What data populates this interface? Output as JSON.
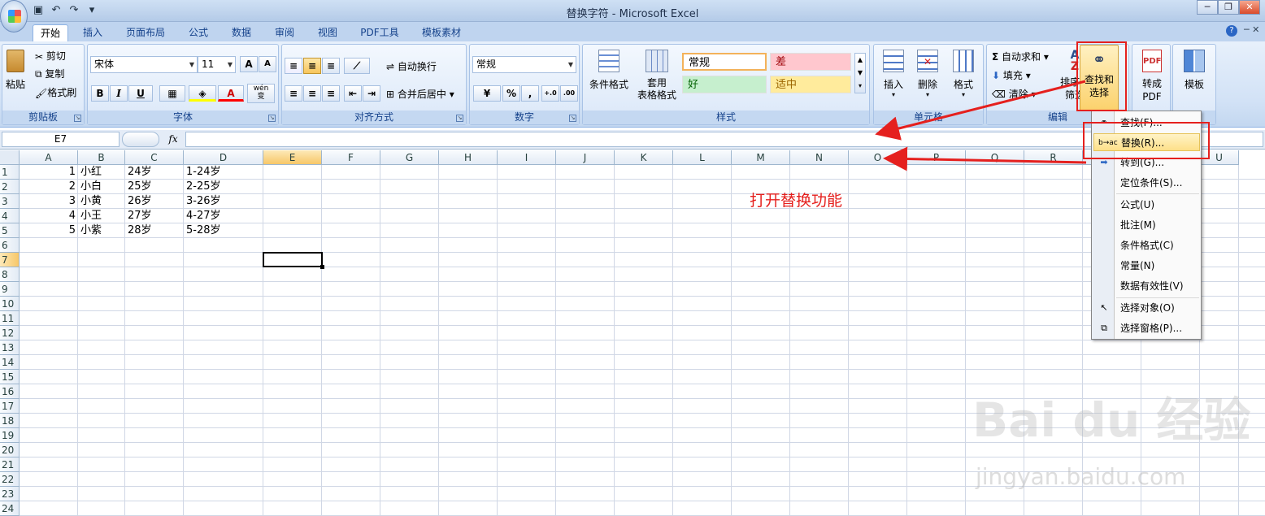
{
  "window": {
    "title": "替换字符 - Microsoft Excel"
  },
  "qat": [
    "save-icon",
    "undo-icon",
    "redo-icon",
    "customize-icon"
  ],
  "tabs": [
    "开始",
    "插入",
    "页面布局",
    "公式",
    "数据",
    "审阅",
    "视图",
    "PDF工具",
    "模板素材"
  ],
  "clipboard": {
    "paste": "粘贴",
    "cut": "剪切",
    "copy": "复制",
    "format_painter": "格式刷",
    "label": "剪贴板"
  },
  "font": {
    "name": "宋体",
    "size": "11",
    "label": "字体",
    "bold": "B",
    "italic": "I",
    "underline": "U",
    "grow": "A",
    "shrink": "A",
    "color_a": "A",
    "wen": "wén\n变"
  },
  "alignment": {
    "wrap": "自动换行",
    "merge": "合并后居中",
    "label": "对齐方式"
  },
  "number": {
    "format": "常规",
    "label": "数字",
    "percent": "%",
    "comma": ","
  },
  "styles": {
    "conditional": "条件格式",
    "table": "套用\n表格格式",
    "label": "样式",
    "cells": [
      "常规",
      "差",
      "好",
      "适中"
    ]
  },
  "cells_group": {
    "insert": "插入",
    "delete": "删除",
    "format": "格式",
    "label": "单元格"
  },
  "editing": {
    "autosum": "自动求和",
    "fill": "填充",
    "clear": "清除",
    "sort": "排序和\n筛选",
    "find": "查找和\n选择",
    "label": "编辑"
  },
  "pdf": {
    "convert": "转成\nPDF"
  },
  "template": {
    "label": "模板"
  },
  "formula_bar": {
    "namebox": "E7",
    "fx": "fx",
    "value": ""
  },
  "columns": [
    "A",
    "B",
    "C",
    "D",
    "E",
    "F",
    "G",
    "H",
    "I",
    "J",
    "K",
    "L",
    "M",
    "N",
    "O",
    "P",
    "Q",
    "R",
    "S",
    "T",
    "U"
  ],
  "rows": [
    "1",
    "2",
    "3",
    "4",
    "5",
    "6",
    "7",
    "8",
    "9",
    "10",
    "11",
    "12",
    "13",
    "14",
    "15",
    "16",
    "17",
    "18",
    "19",
    "20",
    "21",
    "22",
    "23",
    "24"
  ],
  "sheet": [
    [
      "1",
      "小红",
      "24岁",
      "1-24岁"
    ],
    [
      "2",
      "小白",
      "25岁",
      "2-25岁"
    ],
    [
      "3",
      "小黄",
      "26岁",
      "3-26岁"
    ],
    [
      "4",
      "小王",
      "27岁",
      "4-27岁"
    ],
    [
      "5",
      "小紫",
      "28岁",
      "5-28岁"
    ]
  ],
  "menu": {
    "items": [
      "查找(F)...",
      "替换(R)...",
      "转到(G)...",
      "定位条件(S)...",
      "公式(U)",
      "批注(M)",
      "条件格式(C)",
      "常量(N)",
      "数据有效性(V)",
      "选择对象(O)",
      "选择窗格(P)..."
    ]
  },
  "annotation": "打开替换功能",
  "watermark": {
    "main": "Bai du 经验",
    "sub": "jingyan.baidu.com"
  },
  "colors": {
    "accent": "#e5201e",
    "highlight": "#fde089",
    "ribbon": "#d2e2f6"
  }
}
